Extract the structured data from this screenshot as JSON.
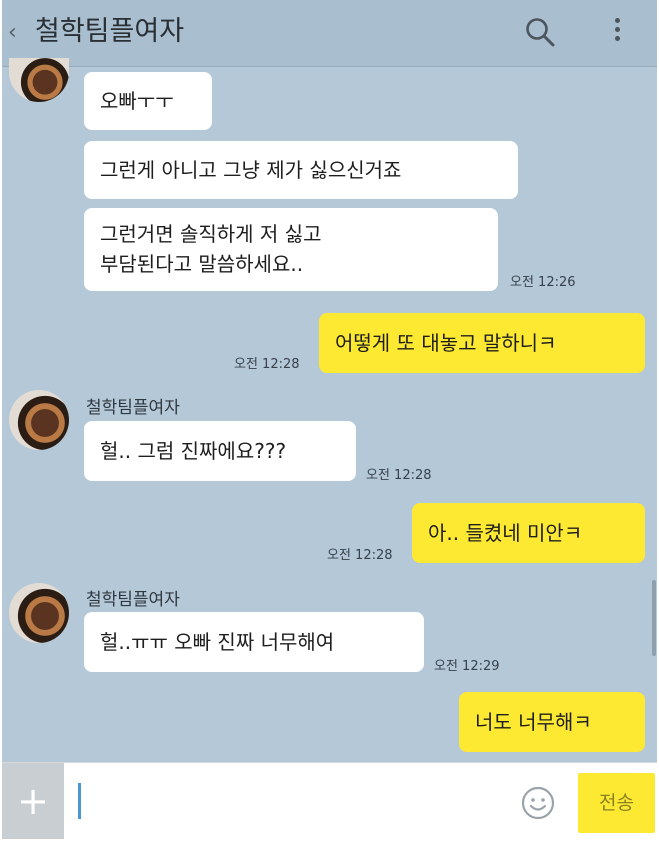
{
  "header": {
    "title": "철학팀플여자",
    "back_icon": "chevron-left-icon",
    "search_icon": "search-icon",
    "menu_icon": "more-vertical-icon"
  },
  "messages": [
    {
      "side": "in",
      "text": "오빠ㅜㅜ"
    },
    {
      "side": "in",
      "text": "그런게 아니고 그냥 제가 싫으신거죠"
    },
    {
      "side": "in",
      "lines": [
        "그런거면 솔직하게 저 싫고",
        "부담된다고 말씀하세요.."
      ],
      "time": "오전 12:26"
    },
    {
      "side": "out",
      "text": "어떻게 또 대놓고 말하니ㅋ",
      "time": "오전 12:28"
    },
    {
      "side": "in",
      "sender": "철학팀플여자",
      "text": "헐.. 그럼 진짜에요???",
      "time": "오전 12:28"
    },
    {
      "side": "out",
      "text": "아.. 들켰네 미안ㅋ",
      "time": "오전 12:28"
    },
    {
      "side": "in",
      "sender": "철학팀플여자",
      "text": "헐..ㅠㅠ 오빠 진짜 너무해여",
      "time": "오전 12:29"
    },
    {
      "side": "out",
      "text": "너도 너무해ㅋ"
    }
  ],
  "input": {
    "plus_label": "+",
    "placeholder": "",
    "send_label": "전송",
    "emoji_icon": "smiley-icon"
  },
  "colors": {
    "background": "#b5c8d8",
    "outgoing_bubble": "#fde932",
    "incoming_bubble": "#ffffff"
  }
}
